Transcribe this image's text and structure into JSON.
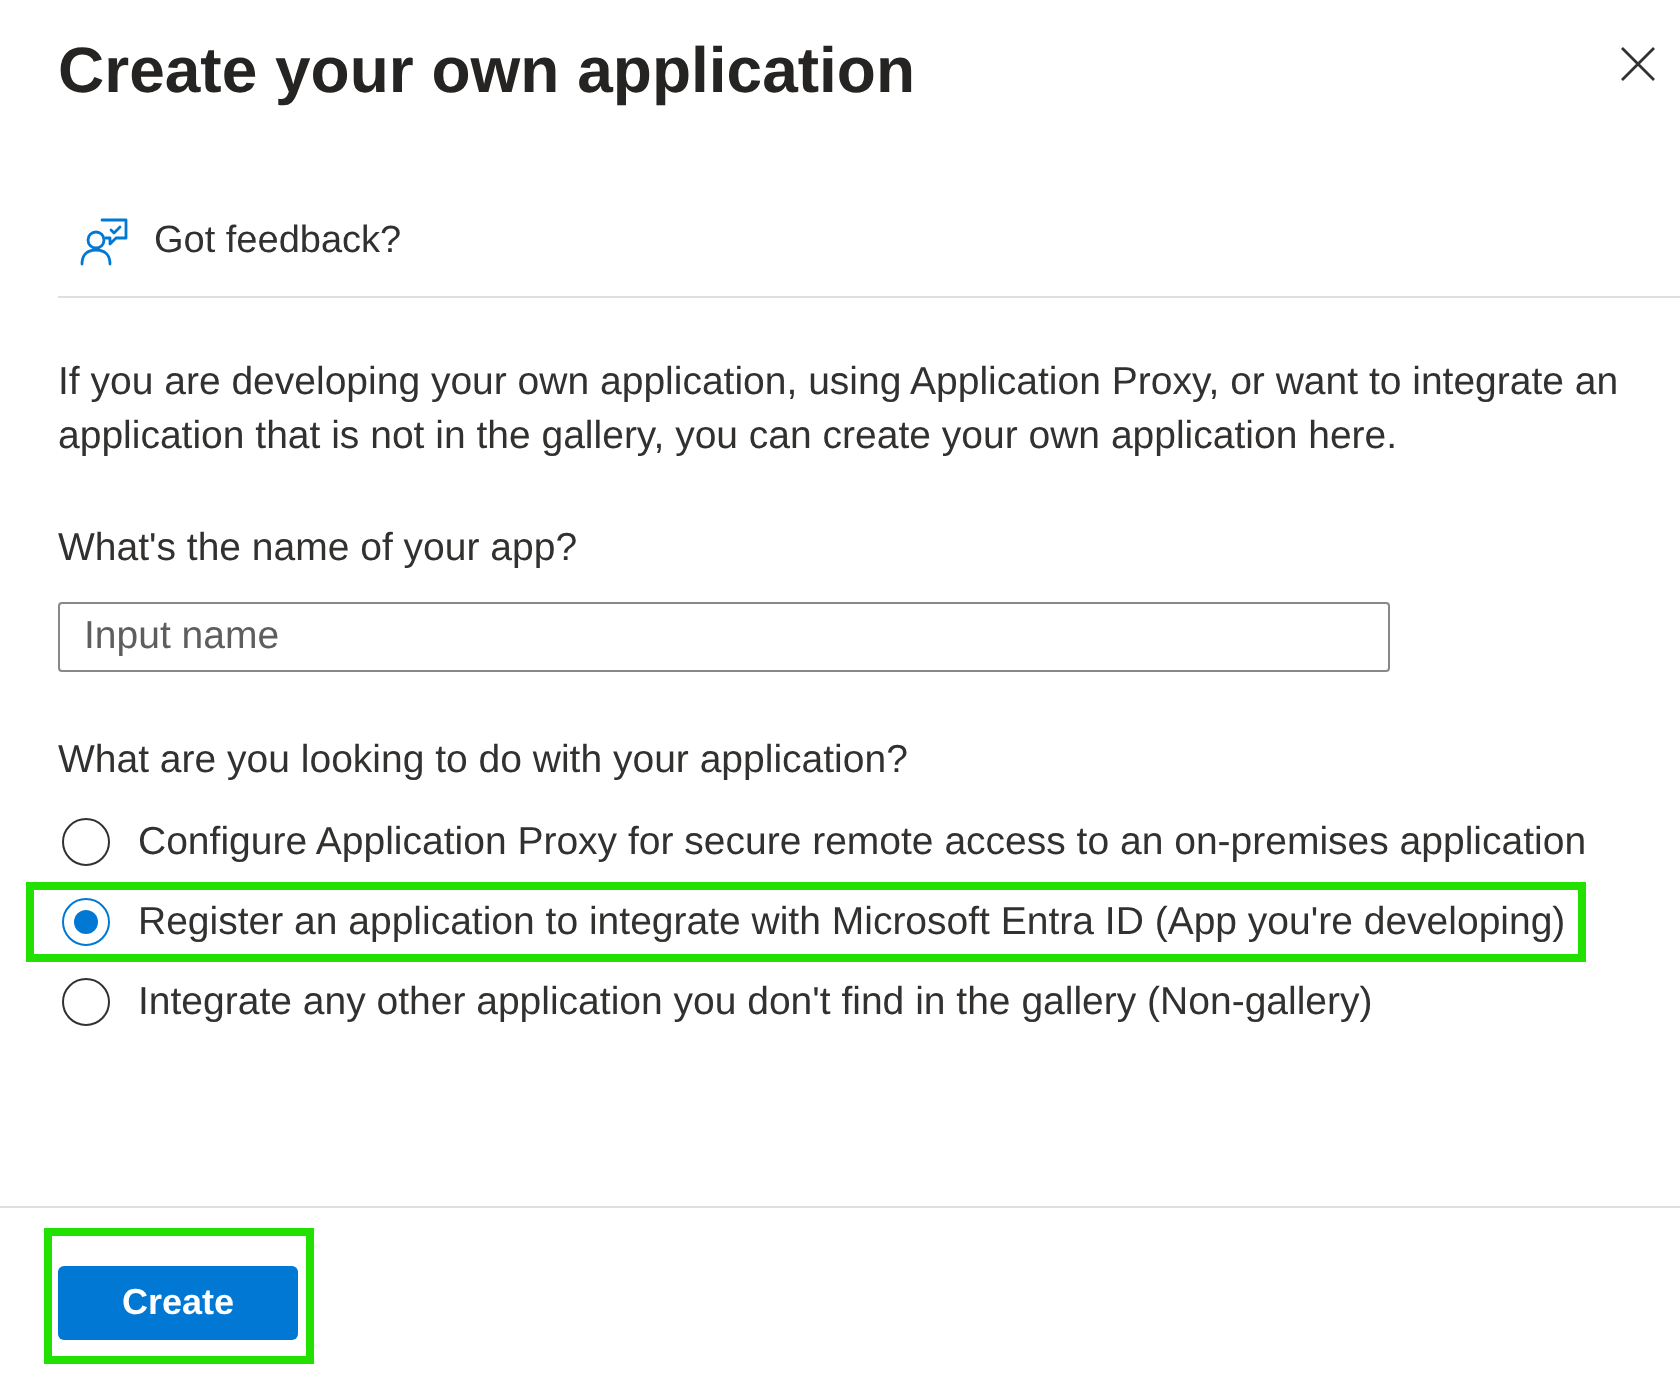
{
  "panel": {
    "title": "Create your own application"
  },
  "feedback": {
    "label": "Got feedback?"
  },
  "description": "If you are developing your own application, using Application Proxy, or want to integrate an application that is not in the gallery, you can create your own application here.",
  "name_field": {
    "label": "What's the name of your app?",
    "placeholder": "Input name"
  },
  "purpose": {
    "label": "What are you looking to do with your application?",
    "options": [
      {
        "label": "Configure Application Proxy for secure remote access to an on-premises application",
        "selected": false,
        "highlighted": false
      },
      {
        "label": "Register an application to integrate with Microsoft Entra ID (App you're developing)",
        "selected": true,
        "highlighted": true
      },
      {
        "label": "Integrate any other application you don't find in the gallery (Non-gallery)",
        "selected": false,
        "highlighted": false
      }
    ]
  },
  "footer": {
    "button": {
      "label": "Create",
      "highlighted": true
    }
  }
}
